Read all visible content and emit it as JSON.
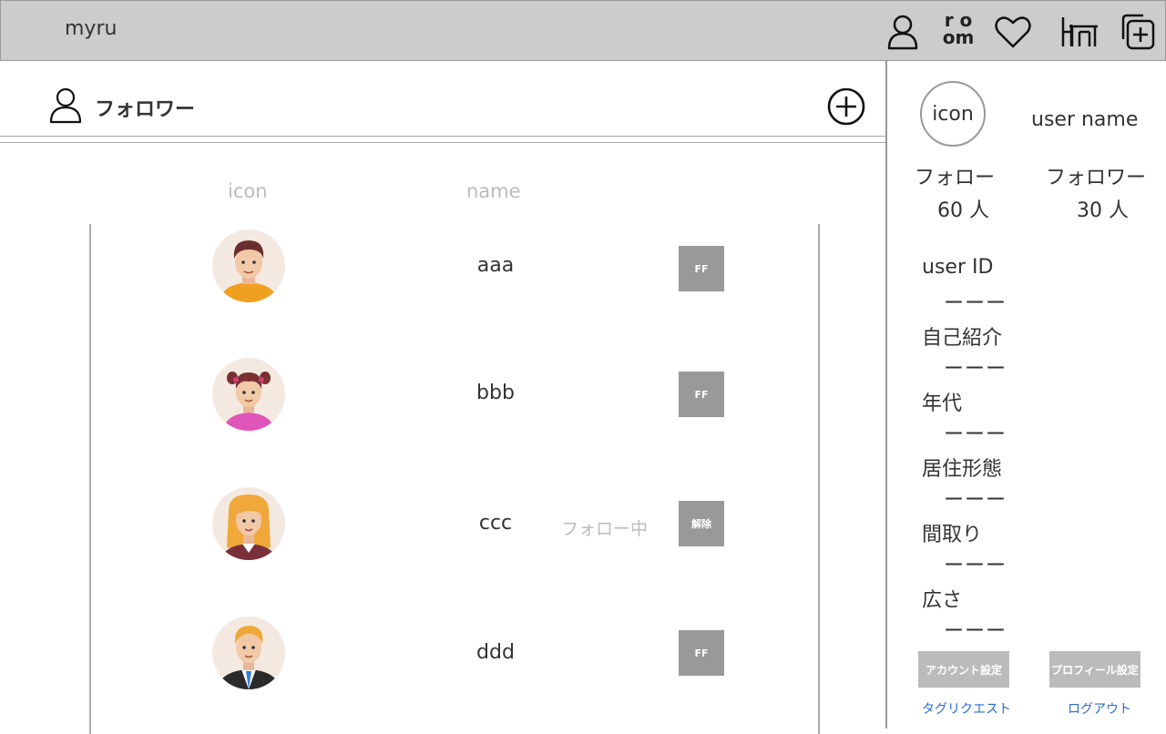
{
  "app": {
    "brand": "myru"
  },
  "topbar": {
    "icons": [
      "user-icon",
      "room-icon",
      "heart-icon",
      "furniture-icon",
      "add-post-icon"
    ],
    "room_icon_top": "r o",
    "room_icon_bottom": "om"
  },
  "page": {
    "title": "フォロワー"
  },
  "list": {
    "headers": {
      "icon": "icon",
      "name": "name"
    },
    "rows": [
      {
        "name": "aaa",
        "status": "",
        "button": "FF",
        "avatar": "man-orange-shirt"
      },
      {
        "name": "bbb",
        "status": "",
        "button": "FF",
        "avatar": "girl-pigtails-pink"
      },
      {
        "name": "ccc",
        "status": "フォロー中",
        "button": "解除",
        "avatar": "woman-blonde-maroon"
      },
      {
        "name": "ddd",
        "status": "",
        "button": "FF",
        "avatar": "man-suit-blue-tie"
      }
    ]
  },
  "sidebar": {
    "icon_label": "icon",
    "username": "user name",
    "follow_label": "フォロー",
    "follow_count": "60 人",
    "follower_label": "フォロワー",
    "follower_count": "30 人",
    "fields": [
      {
        "label": "user ID",
        "value": "ーーー"
      },
      {
        "label": "自己紹介",
        "value": "ーーー"
      },
      {
        "label": "年代",
        "value": "ーーー"
      },
      {
        "label": "居住形態",
        "value": "ーーー"
      },
      {
        "label": "間取り",
        "value": "ーーー"
      },
      {
        "label": "広さ",
        "value": "ーーー"
      }
    ],
    "account_settings": "アカウント設定",
    "profile_settings": "プロフィール設定",
    "tag_request": "タグリクエスト",
    "logout": "ログアウト"
  }
}
